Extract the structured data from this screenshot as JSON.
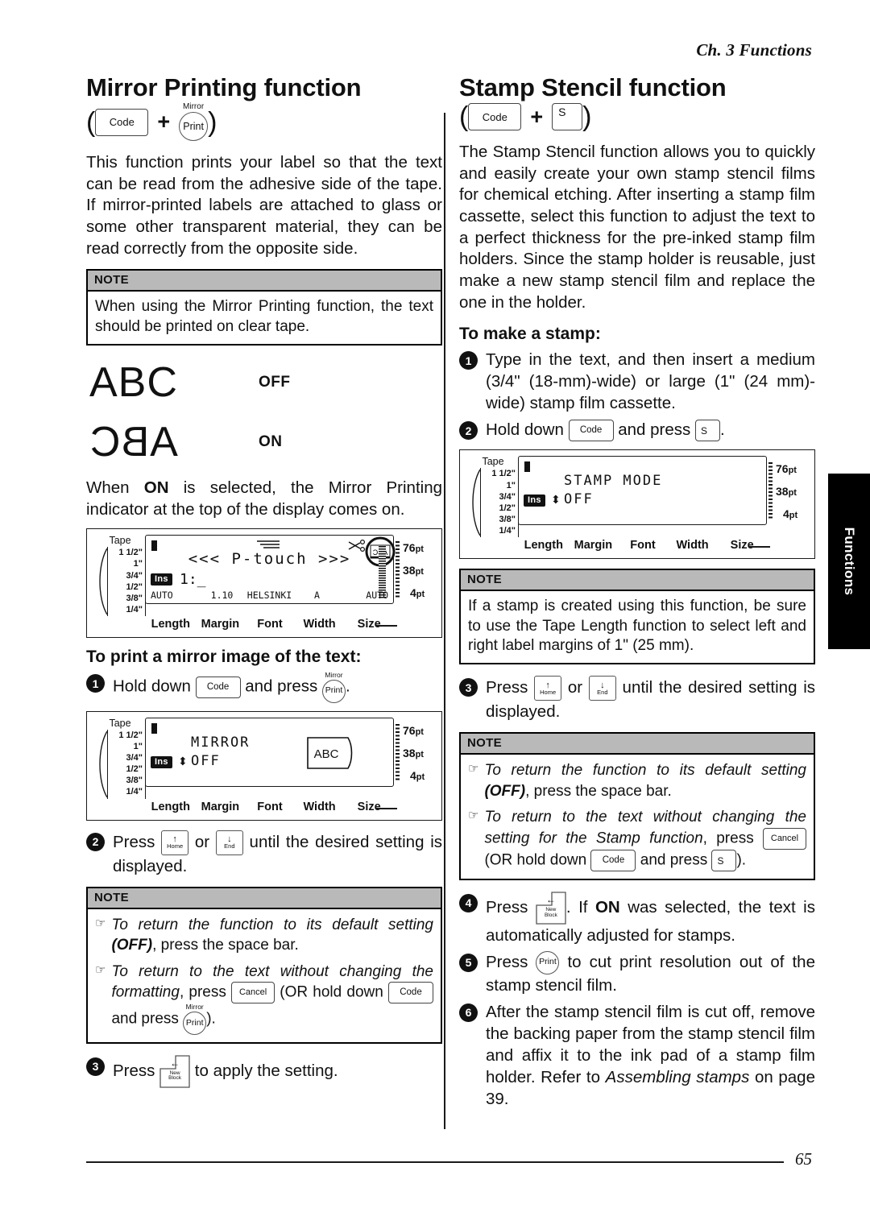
{
  "running_head": "Ch. 3 Functions",
  "page_number": "65",
  "side_tab": {
    "label": "Functions"
  },
  "keys": {
    "code": "Code",
    "print": "Print",
    "mirror_cap": "Mirror",
    "s": "S",
    "cancel": "Cancel",
    "home_label": "Home",
    "end_label": "End",
    "home_arrow": "↑",
    "end_arrow": "↓",
    "enter_arrow": "←",
    "new_block_l1": "New",
    "new_block_l2": "Block",
    "plus": "+",
    "paren_open": "(",
    "paren_close": ")"
  },
  "left_column": {
    "title": "Mirror Printing function",
    "intro": "This function prints your label so that the text can be read from the adhesive side of the tape. If mirror-printed labels are attached to glass or some other transparent material, they can be read correctly from the opposite side.",
    "note1": {
      "header": "NOTE",
      "text": "When using the Mirror Printing function, the text should be printed on clear tape."
    },
    "abc_graphic": {
      "normal_text": "ABC",
      "normal_label": "OFF",
      "mirror_text": "ABC",
      "mirror_label": "ON"
    },
    "after_graphic_pre": "When ",
    "after_graphic_bold": "ON",
    "after_graphic_post": " is selected, the Mirror Printing indicator at the top of the display comes on.",
    "lcd1": {
      "tape_title": "Tape",
      "tape_sizes": [
        "1 1/2\"",
        "1\"",
        "3/4\"",
        "1/2\"",
        "3/8\"",
        "1/4\""
      ],
      "ins": "Ins",
      "main_text": "<<< P-touch >>>",
      "line_num": "1:_",
      "status": [
        "AUTO",
        "1.10",
        "HELSINKI",
        "A",
        "AUTO"
      ],
      "bottom_labels": [
        "Length",
        "Margin",
        "Font",
        "Width",
        "Size"
      ],
      "pt_sizes": [
        "76",
        "38",
        "4"
      ],
      "pt_unit": "pt",
      "mirror_indicator": "ABC"
    },
    "subhead": "To print a mirror image of the text:",
    "step1_pre": "Hold down ",
    "step1_mid": " and press ",
    "step1_post": ".",
    "lcd2": {
      "tape_title": "Tape",
      "tape_sizes": [
        "1 1/2\"",
        "1\"",
        "3/4\"",
        "1/2\"",
        "3/8\"",
        "1/4\""
      ],
      "ins": "Ins",
      "line1": "MIRROR",
      "line2": "OFF",
      "tag": "ABC",
      "bottom_labels": [
        "Length",
        "Margin",
        "Font",
        "Width",
        "Size"
      ],
      "pt_sizes": [
        "76",
        "38",
        "4"
      ],
      "pt_unit": "pt"
    },
    "step2_pre": "Press ",
    "step2_mid": " or ",
    "step2_post": " until the desired setting is displayed.",
    "note2": {
      "header": "NOTE",
      "item1_a": "To return the function to its default setting ",
      "item1_b": "(OFF)",
      "item1_c": ", press the space bar.",
      "item2_a": "To return to the text without changing the formatting",
      "item2_b": ", press ",
      "item2_c": " (OR hold down ",
      "item2_d": " and press ",
      "item2_e": ")."
    },
    "step3_pre": "Press ",
    "step3_post": " to apply the setting."
  },
  "right_column": {
    "title": "Stamp Stencil function",
    "intro": "The Stamp Stencil function allows you to quickly and easily create your own stamp stencil films for chemical etching. After inserting a stamp film cassette, select this function to adjust the text to a perfect thickness for the pre-inked stamp film holders. Since the stamp holder is reusable, just make a new stamp stencil film and replace the one in the holder.",
    "subhead": "To make a stamp:",
    "step1": "Type in the text, and then insert a medium (3/4\" (18-mm)-wide) or large (1\" (24 mm)-wide) stamp film cassette.",
    "step2_pre": "Hold down ",
    "step2_mid": " and press ",
    "step2_post": ".",
    "lcd3": {
      "tape_title": "Tape",
      "tape_sizes": [
        "1 1/2\"",
        "1\"",
        "3/4\"",
        "1/2\"",
        "3/8\"",
        "1/4\""
      ],
      "ins": "Ins",
      "line1": "STAMP MODE",
      "line2": "OFF",
      "bottom_labels": [
        "Length",
        "Margin",
        "Font",
        "Width",
        "Size"
      ],
      "pt_sizes": [
        "76",
        "38",
        "4"
      ],
      "pt_unit": "pt"
    },
    "note1": {
      "header": "NOTE",
      "text": "If a stamp is created using this function, be sure to use the Tape Length function to select left and right label margins of 1\" (25 mm)."
    },
    "step3_pre": "Press ",
    "step3_mid": " or ",
    "step3_post": " until the desired setting is displayed.",
    "note2": {
      "header": "NOTE",
      "item1_a": "To return the function to its default setting ",
      "item1_b": "(OFF)",
      "item1_c": ", press the space bar.",
      "item2_a": "To return to the text without changing the setting for the Stamp function",
      "item2_b": ", press ",
      "item2_c": " (OR hold down ",
      "item2_d": " and press ",
      "item2_e": ")."
    },
    "step4_pre": "Press ",
    "step4_mid": ". If ",
    "step4_bold": "ON",
    "step4_post": " was selected, the text is automatically adjusted for stamps.",
    "step5_pre": "Press ",
    "step5_post": " to cut print resolution out of the stamp stencil film.",
    "step6_a": "After the stamp stencil film is cut off, remove the backing paper from the stamp stencil film and affix it to the ink pad of a stamp film holder. Refer to ",
    "step6_italic": "Assembling stamps",
    "step6_b": " on page 39."
  }
}
